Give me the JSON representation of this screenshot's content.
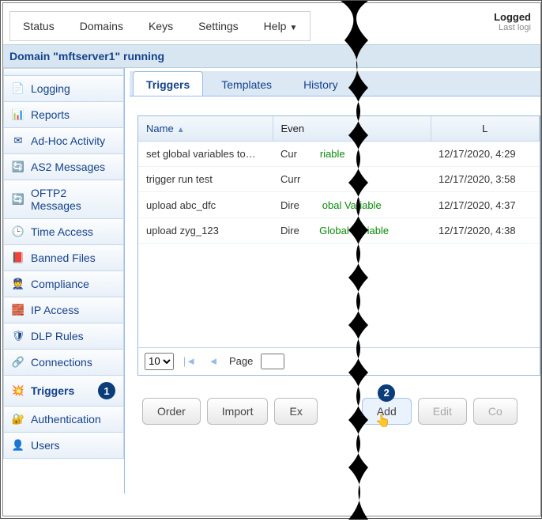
{
  "topnav": {
    "status": "Status",
    "domains": "Domains",
    "keys": "Keys",
    "settings": "Settings",
    "help": "Help"
  },
  "login": {
    "line1": "Logged",
    "line2": "Last logi"
  },
  "domain_bar": "Domain \"mftserver1\" running",
  "sidebar": {
    "items": [
      {
        "label": "Logging",
        "icon": "📄"
      },
      {
        "label": "Reports",
        "icon": "📊"
      },
      {
        "label": "Ad-Hoc Activity",
        "icon": "✉"
      },
      {
        "label": "AS2 Messages",
        "icon": "🔄"
      },
      {
        "label": "OFTP2 Messages",
        "icon": "🔄"
      },
      {
        "label": "Time Access",
        "icon": "🕒"
      },
      {
        "label": "Banned Files",
        "icon": "📕"
      },
      {
        "label": "Compliance",
        "icon": "👮"
      },
      {
        "label": "IP Access",
        "icon": "🧱"
      },
      {
        "label": "DLP Rules",
        "icon": "🛡"
      },
      {
        "label": "Connections",
        "icon": "🔗"
      },
      {
        "label": "Triggers",
        "icon": "💥",
        "active": true,
        "step": "1"
      },
      {
        "label": "Authentication",
        "icon": "🔐"
      },
      {
        "label": "Users",
        "icon": "👤"
      }
    ]
  },
  "tabs": {
    "triggers": "Triggers",
    "templates": "Templates",
    "history": "History"
  },
  "table": {
    "headers": {
      "name": "Name",
      "event": "Even",
      "last": "L"
    },
    "rows": [
      {
        "name": "set global variables to…",
        "event_a": "Cur",
        "event_b": "riable",
        "last": "12/17/2020, 4:29"
      },
      {
        "name": "trigger run test",
        "event_a": "Curr",
        "event_b": "",
        "last": "12/17/2020, 3:58"
      },
      {
        "name": "upload abc_dfc",
        "event_a": "Dire",
        "event_b": "obal Variable",
        "last": "12/17/2020, 4:37"
      },
      {
        "name": "upload zyg_123",
        "event_a": "Dire",
        "event_b": "Global Variable",
        "last": "12/17/2020, 4:38"
      }
    ]
  },
  "pager": {
    "size": "10",
    "page_label": "Page"
  },
  "buttons": {
    "order": "Order",
    "import": "Import",
    "export": "Ex",
    "add": "Add",
    "edit": "Edit",
    "copy": "Co"
  },
  "steps": {
    "add": "2"
  }
}
